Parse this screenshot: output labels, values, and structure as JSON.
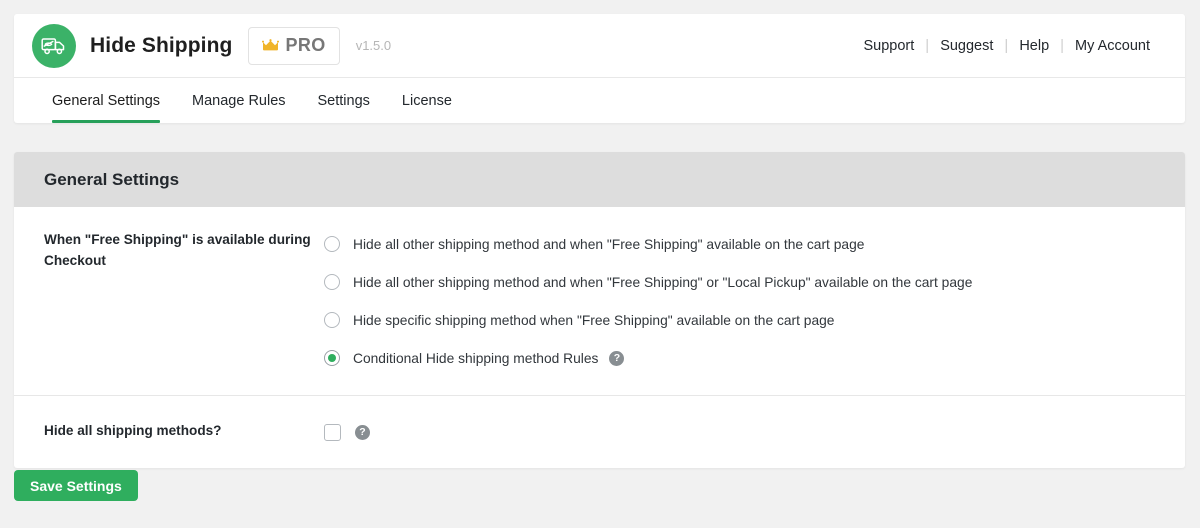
{
  "header": {
    "logo_icon": "hidden-shipping-truck-icon",
    "brand_name": "Hide Shipping",
    "pro_badge": {
      "icon": "crown-icon",
      "label": "PRO"
    },
    "version": "v1.5.0",
    "nav_links": [
      {
        "label": "Support"
      },
      {
        "label": "Suggest"
      },
      {
        "label": "Help"
      },
      {
        "label": "My Account"
      }
    ],
    "nav_separator": "|"
  },
  "tabs": [
    {
      "label": "General Settings",
      "active": true
    },
    {
      "label": "Manage Rules",
      "active": false
    },
    {
      "label": "Settings",
      "active": false
    },
    {
      "label": "License",
      "active": false
    }
  ],
  "panel": {
    "title": "General Settings",
    "rows": [
      {
        "label": "When \"Free Shipping\" is available during Checkout",
        "type": "radio-group",
        "options": [
          {
            "label": "Hide all other shipping method and when \"Free Shipping\" available on the cart page",
            "checked": false,
            "help": false
          },
          {
            "label": "Hide all other shipping method and when \"Free Shipping\" or \"Local Pickup\" available on the cart page",
            "checked": false,
            "help": false
          },
          {
            "label": "Hide specific shipping method when \"Free Shipping\" available on the cart page",
            "checked": false,
            "help": false
          },
          {
            "label": "Conditional Hide shipping method Rules",
            "checked": true,
            "help": true
          }
        ]
      },
      {
        "label": "Hide all shipping methods?",
        "type": "checkbox",
        "checked": false,
        "help": true
      }
    ]
  },
  "footer": {
    "save_label": "Save Settings"
  },
  "icons": {
    "help_glyph": "?"
  },
  "colors": {
    "brand_green": "#3bb268",
    "accent_green": "#27a05a",
    "save_green": "#2fae5e",
    "crown_gold": "#f0b429",
    "page_bg": "#f1f1f1",
    "panel_head_bg": "#dddddd"
  }
}
